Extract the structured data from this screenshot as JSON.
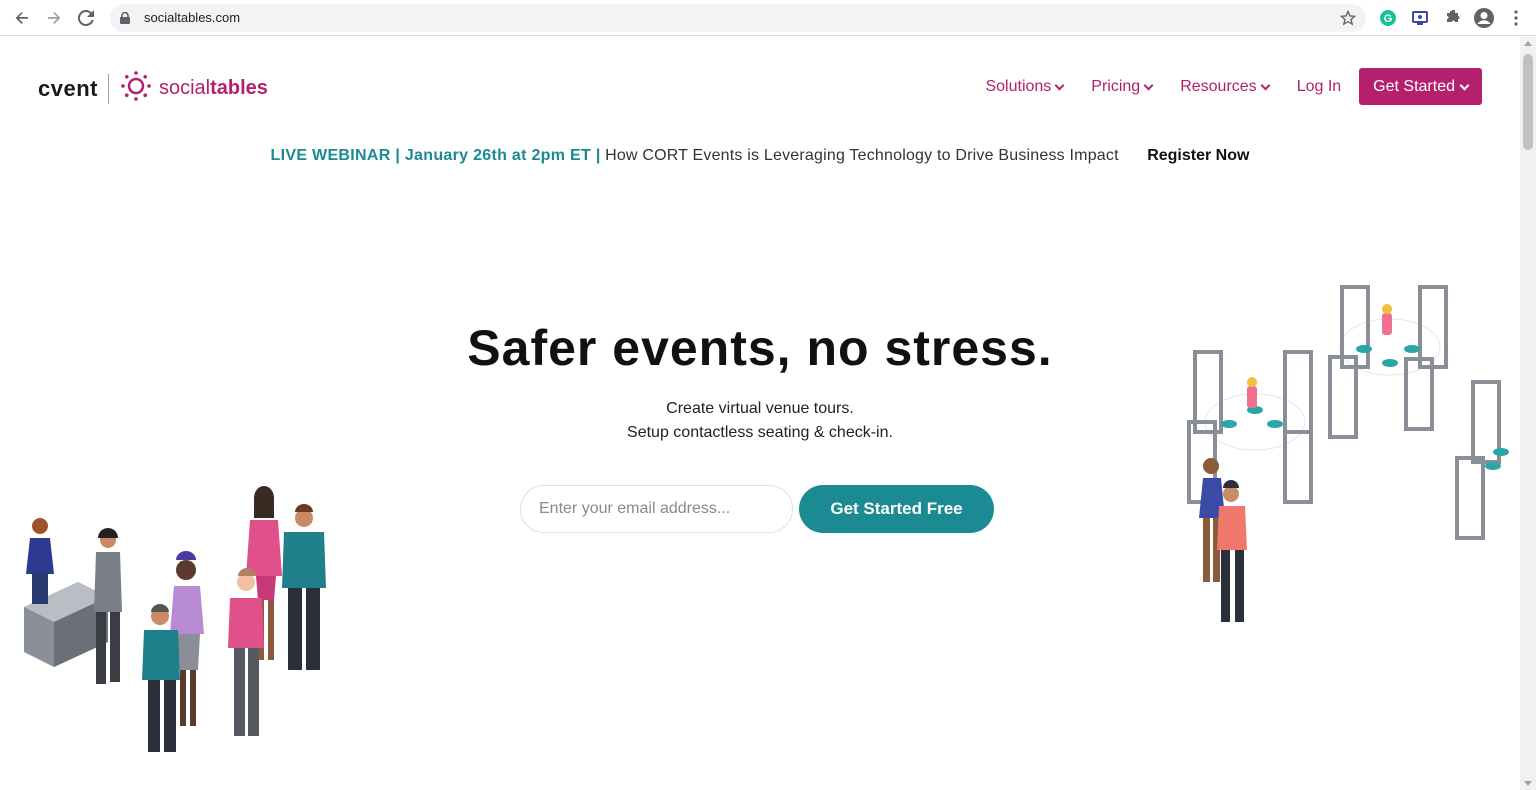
{
  "browser": {
    "url": "socialtables.com"
  },
  "header": {
    "logo_cvent": "cvent",
    "logo_social": "social",
    "logo_tables": "tables",
    "nav": [
      {
        "label": "Solutions"
      },
      {
        "label": "Pricing"
      },
      {
        "label": "Resources"
      }
    ],
    "login": "Log In",
    "get_started": "Get Started"
  },
  "banner": {
    "highlight": "LIVE WEBINAR | January 26th at 2pm ET |",
    "description": "How CORT Events is Leveraging Technology to Drive Business Impact",
    "register": "Register Now"
  },
  "hero": {
    "title": "Safer events, no stress.",
    "line1": "Create virtual venue tours.",
    "line2": "Setup contactless seating & check-in.",
    "email_placeholder": "Enter your email address...",
    "cta": "Get Started Free"
  },
  "colors": {
    "brand": "#b5206e",
    "teal": "#1b8a93"
  }
}
